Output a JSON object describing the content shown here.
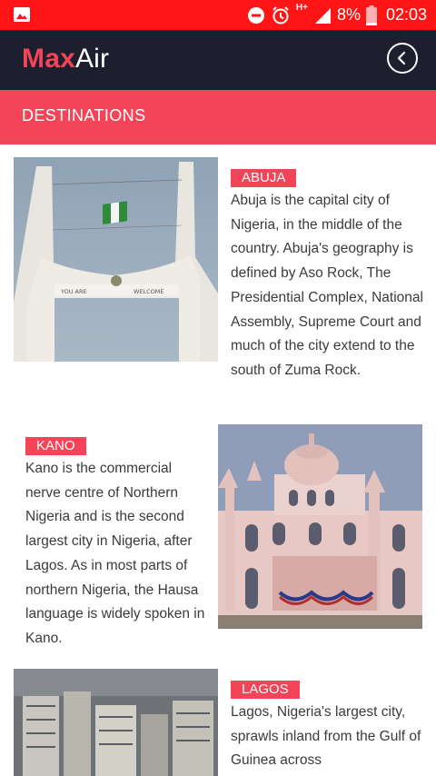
{
  "status_bar": {
    "battery": "8%",
    "time": "02:03",
    "network": "H+",
    "icons": [
      "gallery-icon",
      "dnd-icon",
      "alarm-icon",
      "signal-icon",
      "battery-icon"
    ]
  },
  "app": {
    "logo_part1": "Max",
    "logo_part2": "Air",
    "back_icon": "chevron-left-circle-icon"
  },
  "section_title": "DESTINATIONS",
  "colors": {
    "status_bar": "#ff1515",
    "app_bar": "#1d1f2e",
    "accent": "#f44458"
  },
  "destinations": [
    {
      "name": "ABUJA",
      "description": "Abuja is the capital city of Nigeria, in the middle of the country. Abuja's geography is defined by Aso Rock, The Presidential Complex, National Assembly, Supreme Court and much of the city extend to the south of Zuma Rock."
    },
    {
      "name": "KANO",
      "description": "Kano is the commercial nerve centre of Northern Nigeria and is the second largest city in Nigeria, after Lagos. As in most parts of northern Nigeria, the Hausa language is widely spoken in Kano."
    },
    {
      "name": "LAGOS",
      "description": "Lagos, Nigeria's largest city, sprawls inland from the Gulf of Guinea across"
    }
  ],
  "images": {
    "abuja": {
      "gate_text_left": "YOU ARE",
      "gate_text_right": "WELCOME"
    }
  }
}
